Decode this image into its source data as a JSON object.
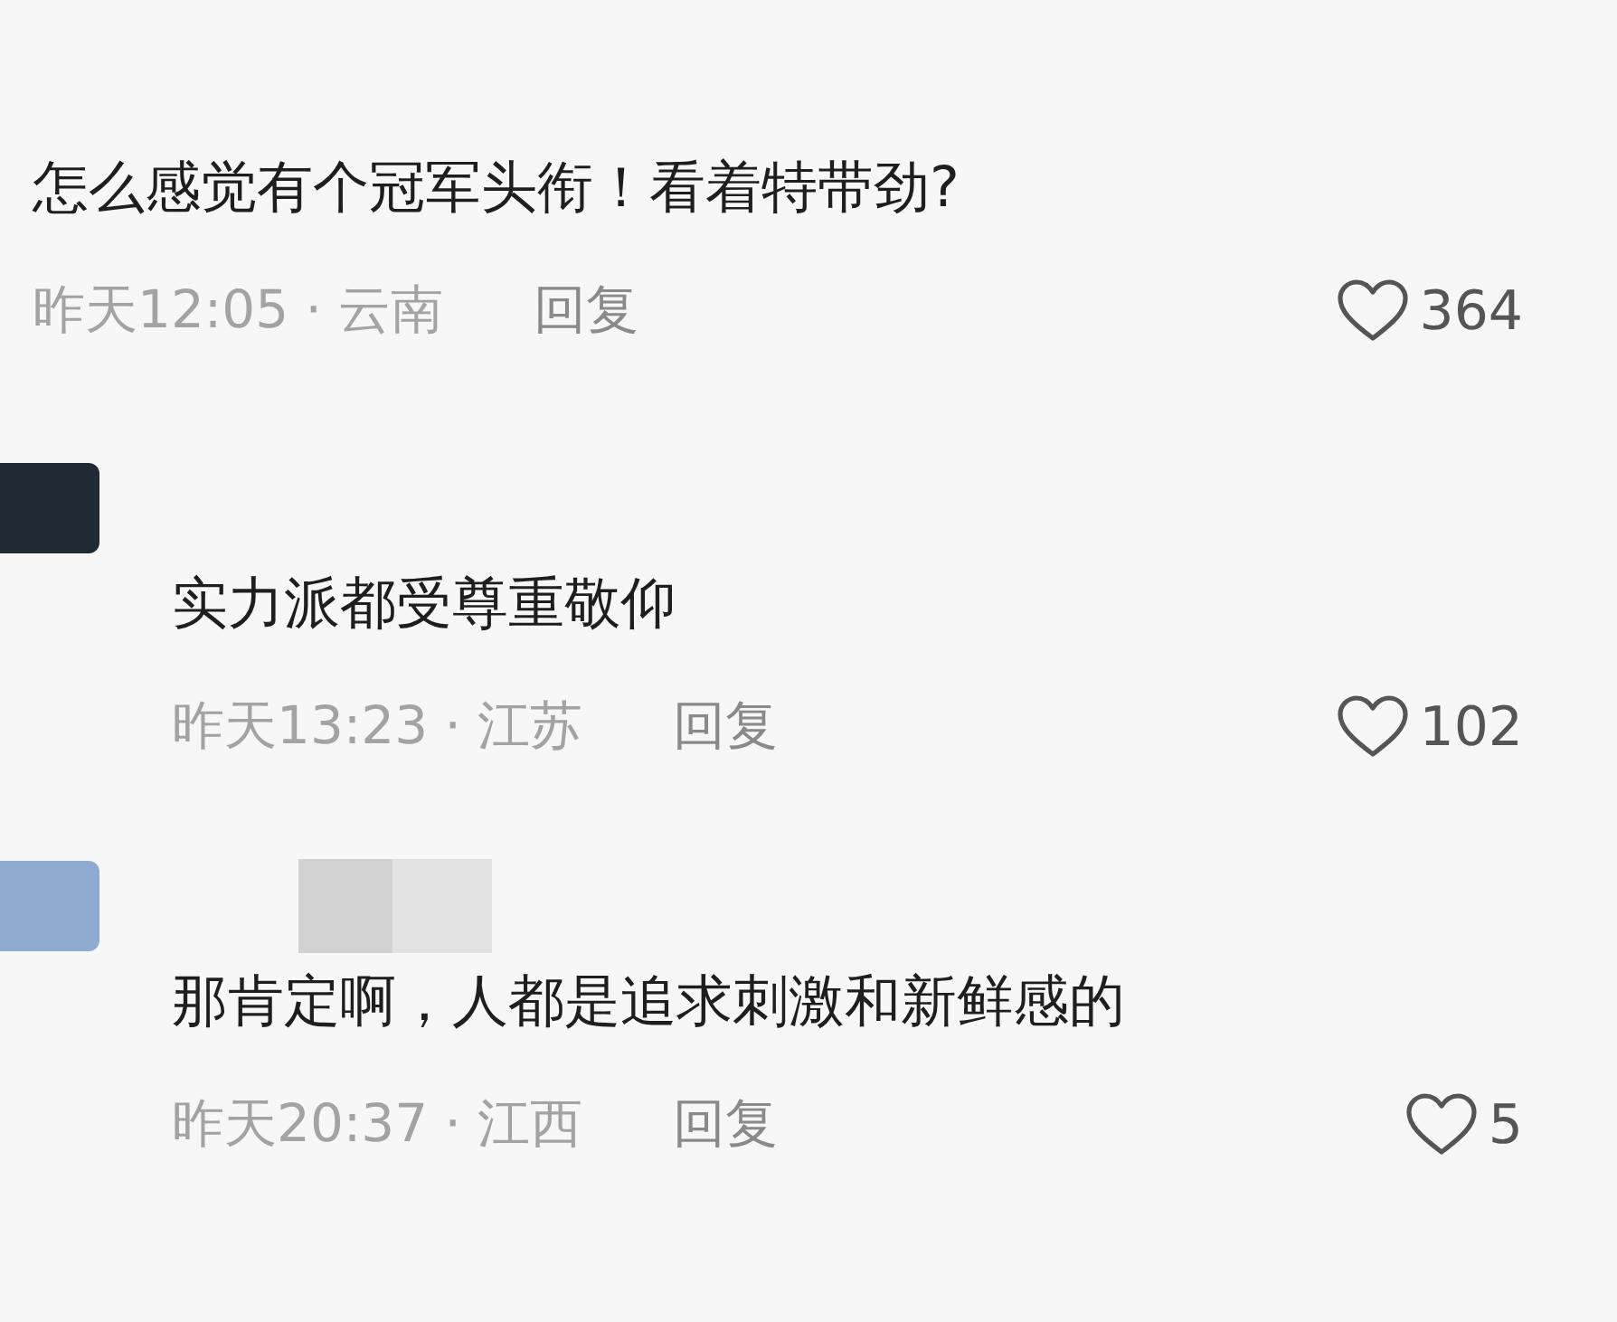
{
  "comments": [
    {
      "kind": "cut",
      "text": "怎么感觉有个冠军头衔！看着特带劲?",
      "time_place": "昨天12:05 · 云南",
      "reply": "回复",
      "likes": "364"
    },
    {
      "kind": "avatar",
      "color": "#1f2a33",
      "name_blurred": false,
      "text": "实力派都受尊重敬仰",
      "time_place": "昨天13:23 · 江苏",
      "reply": "回复",
      "likes": "102"
    },
    {
      "kind": "avatar",
      "color": "#8eaad0",
      "name_blurred": true,
      "text": "那肯定啊，人都是追求刺激和新鲜感的",
      "time_place": "昨天20:37 · 江西",
      "reply": "回复",
      "likes": "5"
    }
  ]
}
